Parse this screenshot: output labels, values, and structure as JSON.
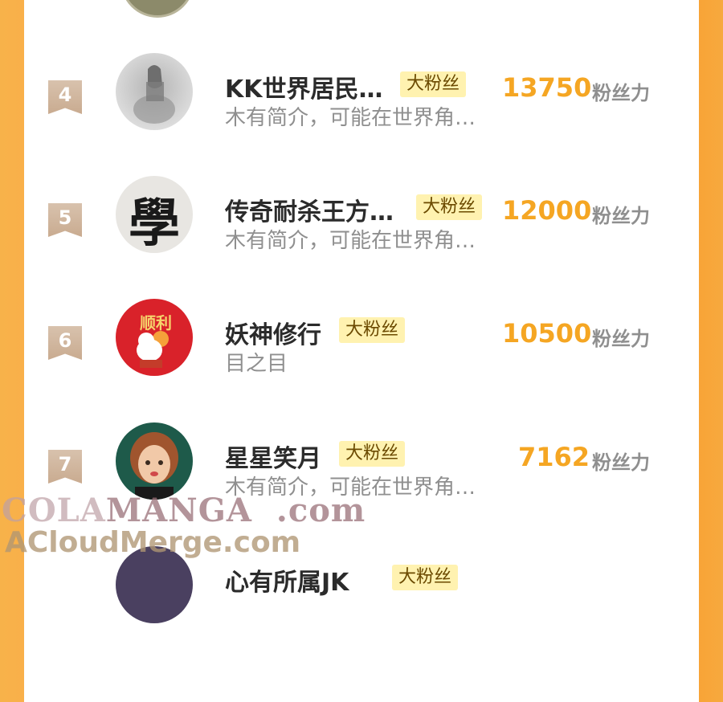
{
  "entries": [
    {
      "rank": "4",
      "name": "KK世界居民…",
      "badge": "大粉丝",
      "bio": "木有简介，可能在世界角…",
      "score": "13750",
      "unit": "粉丝力"
    },
    {
      "rank": "5",
      "name": "传奇耐杀王方…",
      "badge": "大粉丝",
      "bio": "木有简介，可能在世界角…",
      "score": "12000",
      "unit": "粉丝力"
    },
    {
      "rank": "6",
      "name": "妖神修行",
      "badge": "大粉丝",
      "bio": "目之目",
      "score": "10500",
      "unit": "粉丝力"
    },
    {
      "rank": "7",
      "name": "星星笑月",
      "badge": "大粉丝",
      "bio": "木有简介，可能在世界角…",
      "score": "7162",
      "unit": "粉丝力"
    },
    {
      "name": "心有所属JK",
      "badge": "大粉丝"
    }
  ],
  "avatars": {
    "row5_text": "學",
    "row6_text": "顺利"
  },
  "watermark": {
    "line1_a": "COLA",
    "line1_b": "MANGA",
    "line1_c": ".com",
    "line2": "ACloudMerge.com"
  },
  "colors": {
    "accent": "#f5a623",
    "badge_bg": "#fff2b0",
    "side": "#f7a93e"
  }
}
